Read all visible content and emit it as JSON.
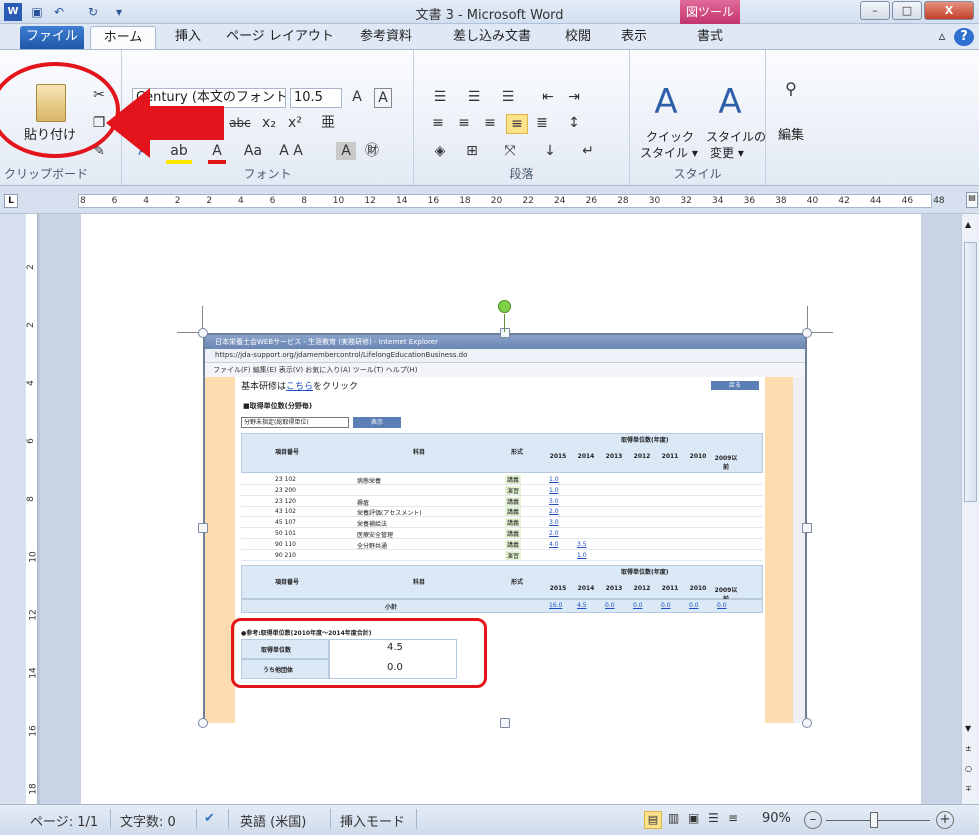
{
  "window": {
    "title": "文書 3 - Microsoft Word",
    "contextual_tab_group": "図ツール",
    "buttons": {
      "minimize": "–",
      "maximize": "□",
      "close": "X"
    }
  },
  "tabs": [
    {
      "label": "ファイル"
    },
    {
      "label": "ホーム"
    },
    {
      "label": "挿入"
    },
    {
      "label": "ページ レイアウト"
    },
    {
      "label": "参考資料"
    },
    {
      "label": "差し込み文書"
    },
    {
      "label": "校閲"
    },
    {
      "label": "表示"
    },
    {
      "label": "書式"
    }
  ],
  "ribbon": {
    "clipboard": {
      "paste_label": "貼り付け",
      "group_label": "クリップボード"
    },
    "font": {
      "font_name": "Century (本文のフォント",
      "font_size": "10.5",
      "group_label": "フォント"
    },
    "paragraph": {
      "group_label": "段落"
    },
    "styles": {
      "quick_style": "クイック",
      "quick_style2": "スタイル ▾",
      "change_style": "スタイルの",
      "change_style2": "変更 ▾",
      "group_label": "スタイル"
    },
    "editing": {
      "label": "編集"
    }
  },
  "ruler": {
    "ticks": [
      "8",
      "6",
      "4",
      "2",
      "2",
      "4",
      "6",
      "8",
      "10",
      "12",
      "14",
      "16",
      "18",
      "20",
      "22",
      "24",
      "26",
      "28",
      "30",
      "32",
      "34",
      "36",
      "38",
      "40",
      "42",
      "44",
      "46",
      "48"
    ]
  },
  "vruler": {
    "ticks": [
      "2",
      "2",
      "4",
      "6",
      "8",
      "10",
      "12",
      "14",
      "16",
      "18"
    ]
  },
  "embedded": {
    "ie_title": "日本栄養士会WEBサービス - 生涯教育 (実務研修) - Internet Explorer",
    "ie_url": "https://jda-support.org/jdamembercontrol/LifelongEducationBusiness.do",
    "ie_menu": "ファイル(F)  編集(E)  表示(V)  お気に入り(A)  ツール(T)  ヘルプ(H)",
    "basic_prefix": "基本研修は",
    "basic_link": "こちら",
    "basic_suffix": "をクリック",
    "back_btn": "戻る",
    "section1": "■取得単位数(分野毎)",
    "select_value": "分野未指定(総取得単位)",
    "display_btn": "表示",
    "col_item": "項目番号",
    "col_subject": "科目",
    "col_format": "形式",
    "col_units": "取得単位数(年度)",
    "years": [
      "2015",
      "2014",
      "2013",
      "2012",
      "2011",
      "2010",
      "2009以前"
    ],
    "rows": [
      {
        "code": "23 102",
        "subject": "病態栄養",
        "format": "講義",
        "v2015": "1.0",
        "v2014": ""
      },
      {
        "code": "23 200",
        "subject": "",
        "format": "演習",
        "v2015": "1.0",
        "v2014": ""
      },
      {
        "code": "23 120",
        "subject": "褥瘡",
        "format": "講義",
        "v2015": "3.0",
        "v2014": ""
      },
      {
        "code": "43 102",
        "subject": "栄養評価(アセスメント)",
        "format": "講義",
        "v2015": "2.0",
        "v2014": ""
      },
      {
        "code": "45 107",
        "subject": "栄養補給法",
        "format": "講義",
        "v2015": "3.0",
        "v2014": ""
      },
      {
        "code": "50 101",
        "subject": "医療安全管理",
        "format": "講義",
        "v2015": "2.0",
        "v2014": ""
      },
      {
        "code": "90 110",
        "subject": "全分野共通",
        "format": "講義",
        "v2015": "4.0",
        "v2014": "3.5"
      },
      {
        "code": "90 210",
        "subject": "",
        "format": "演習",
        "v2015": "",
        "v2014": "1.0"
      }
    ],
    "subtotal_label": "小計",
    "subtotals": [
      "16.0",
      "4.5",
      "0.0",
      "0.0",
      "0.0",
      "0.0",
      "0.0"
    ],
    "section2": "●参考:取得単位数(2010年度～2014年度合計)",
    "ref_rows": [
      {
        "label": "取得単位数",
        "value": "4.5"
      },
      {
        "label": "うち他団体",
        "value": "0.0"
      }
    ]
  },
  "status": {
    "page": "ページ: 1/1",
    "chars": "文字数: 0",
    "lang": "英語 (米国)",
    "mode": "挿入モード",
    "zoom": "90%"
  },
  "colors": {
    "annotation_red": "#e3141b",
    "peach": "#fddcb0",
    "header_blue": "#dbe9f7"
  }
}
